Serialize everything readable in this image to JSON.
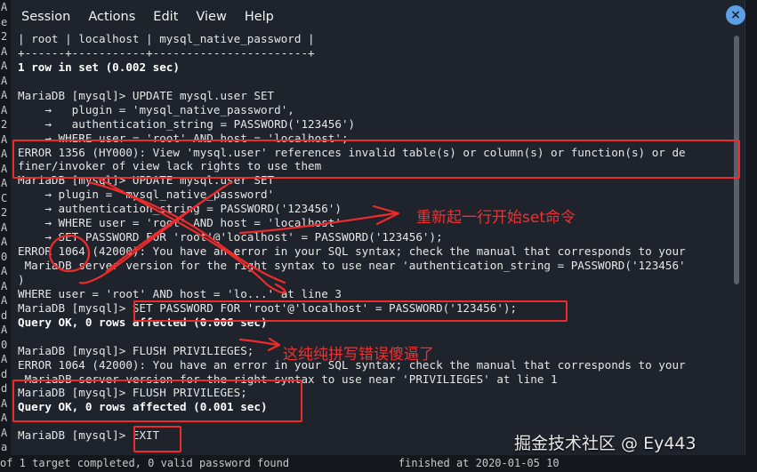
{
  "menu": [
    "Session",
    "Actions",
    "Edit",
    "View",
    "Help"
  ],
  "left_strip": [
    "A",
    "e",
    "2",
    "A",
    "A",
    "A",
    "A",
    "A",
    "2",
    "A",
    "A",
    "A",
    "A",
    "C",
    "2",
    "A",
    "A",
    "0",
    "A",
    "A",
    "A",
    "d",
    "A",
    "0",
    "A",
    "d",
    "d",
    "A",
    "A",
    "A",
    "a",
    "A"
  ],
  "terminal_lines": [
    {
      "text": "| root | localhost | mysql_native_password |",
      "bold": false
    },
    {
      "text": "+------+-----------+-----------------------+",
      "bold": false
    },
    {
      "text": "1 row in set (0.002 sec)",
      "bold": true
    },
    {
      "text": "",
      "bold": false
    },
    {
      "text": "MariaDB [mysql]> UPDATE mysql.user SET",
      "bold": false
    },
    {
      "text": "    →   plugin = 'mysql_native_password',",
      "bold": false
    },
    {
      "text": "    →   authentication_string = PASSWORD('123456')",
      "bold": false
    },
    {
      "text": "    → WHERE user = 'root' AND host = 'localhost';",
      "bold": false
    },
    {
      "text": "ERROR 1356 (HY000): View 'mysql.user' references invalid table(s) or column(s) or function(s) or de",
      "bold": false
    },
    {
      "text": "finer/invoker of view lack rights to use them",
      "bold": false
    },
    {
      "text": "MariaDB [mysql]> UPDATE mysql.user SET",
      "bold": false
    },
    {
      "text": "    → plugin = 'mysql_native_password'",
      "bold": false
    },
    {
      "text": "    → authentication_string = PASSWORD('123456')",
      "bold": false
    },
    {
      "text": "    → WHERE user = 'root' AND host = 'localhost'",
      "bold": false
    },
    {
      "text": "    → SET PASSWORD FOR 'root'@'localhost' = PASSWORD('123456');",
      "bold": false
    },
    {
      "text": "ERROR 1064 (42000): You have an error in your SQL syntax; check the manual that corresponds to your",
      "bold": false
    },
    {
      "text": " MariaDB server version for the right syntax to use near 'authentication_string = PASSWORD('123456'",
      "bold": false
    },
    {
      "text": ")",
      "bold": false
    },
    {
      "text": "WHERE user = 'root' AND host = 'lo...' at line 3",
      "bold": false
    },
    {
      "text": "MariaDB [mysql]> SET PASSWORD FOR 'root'@'localhost' = PASSWORD('123456');",
      "bold": false
    },
    {
      "text": "Query OK, 0 rows affected (0.006 sec)",
      "bold": true
    },
    {
      "text": "",
      "bold": false
    },
    {
      "text": "MariaDB [mysql]> FLUSH PRIVILIEGES;",
      "bold": false
    },
    {
      "text": "ERROR 1064 (42000): You have an error in your SQL syntax; check the manual that corresponds to your",
      "bold": false
    },
    {
      "text": " MariaDB server version for the right syntax to use near 'PRIVILIEGES' at line 1",
      "bold": false
    },
    {
      "text": "MariaDB [mysql]> FLUSH PRIVILEGES;",
      "bold": false
    },
    {
      "text": "Query OK, 0 rows affected (0.001 sec)",
      "bold": true
    },
    {
      "text": "",
      "bold": false
    },
    {
      "text": "MariaDB [mysql]> EXIT",
      "bold": false
    }
  ],
  "bottom_strip": "of 1 target completed, 0 valid password found                 finished at 2020-01-05 10",
  "annotations": {
    "note1": "重新起一行开始set命令",
    "note2": "这纯纯拼写错误傻逼了"
  },
  "watermark": "掘金技术社区 @ Ey443",
  "colors": {
    "background": "#1f232c",
    "text": "#e6e6e6",
    "annotation": "#ee2b2b",
    "close_button": "#5da0e8"
  }
}
